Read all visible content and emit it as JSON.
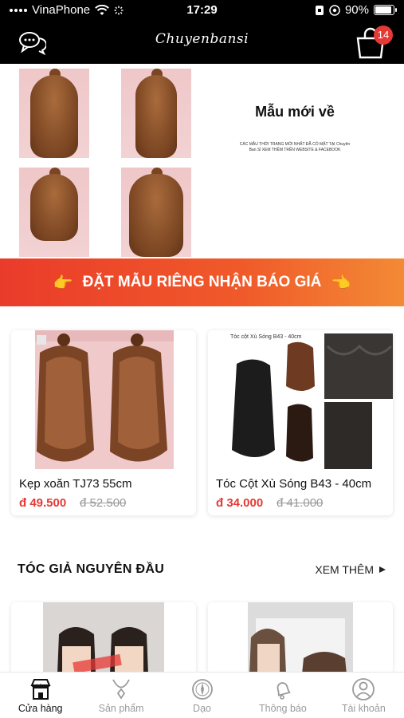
{
  "status_bar": {
    "carrier": "VinaPhone",
    "time": "17:29",
    "battery": "90%",
    "battery_level": 0.9
  },
  "header": {
    "brand": "Chuyenbansi",
    "cart_count": "14"
  },
  "hero": {
    "title": "Mẫu mới về",
    "subtitle": "CÁC MẪU THỜI TRANG MỚI NHẤT ĐÃ CÓ MẶT TẠI Chuyên Ban Sỉ XEM THÊM TRÊN WEBSITE & FACEBOOK"
  },
  "banner": {
    "text": "ĐẶT MẪU RIÊNG NHẬN BÁO GIÁ"
  },
  "products": [
    {
      "name": "Kẹp xoăn TJ73 55cm",
      "price": "đ 49.500",
      "old_price": "đ 52.500"
    },
    {
      "name": "Tóc Cột Xù Sóng B43 - 40cm",
      "price": "đ 34.000",
      "old_price": "đ 41.000",
      "image_label": "Tóc cột Xù Sóng B43 - 40cm"
    }
  ],
  "section": {
    "title": "TÓC GIẢ NGUYÊN ĐẦU",
    "see_more": "XEM THÊM"
  },
  "tabs": [
    {
      "label": "Cửa hàng",
      "icon": "store-icon",
      "active": true
    },
    {
      "label": "Sản phẩm",
      "icon": "necklace-icon",
      "active": false
    },
    {
      "label": "Dạo",
      "icon": "compass-icon",
      "active": false
    },
    {
      "label": "Thông báo",
      "icon": "bell-icon",
      "active": false
    },
    {
      "label": "Tài khoản",
      "icon": "user-icon",
      "active": false
    }
  ],
  "colors": {
    "accent": "#e53935",
    "banner_start": "#ea3b2a",
    "banner_end": "#f38a35",
    "header_bg": "#000000"
  }
}
